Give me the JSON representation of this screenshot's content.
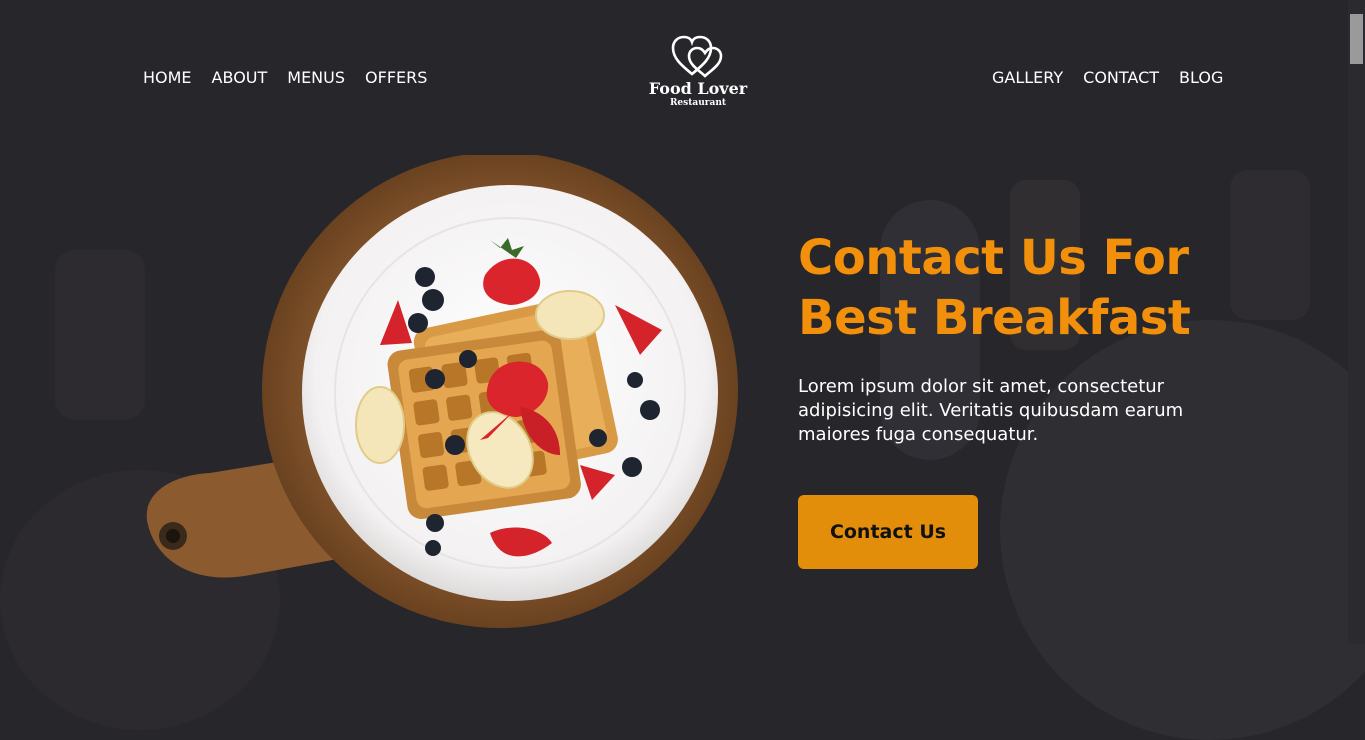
{
  "nav": {
    "left": [
      "HOME",
      "ABOUT",
      "MENUS",
      "OFFERS"
    ],
    "right": [
      "GALLERY",
      "CONTACT",
      "BLOG"
    ]
  },
  "logo": {
    "icon": "hearts-icon",
    "name": "Food Lover",
    "subtitle": "Restaurant"
  },
  "hero": {
    "title_line1": "Contact Us For",
    "title_line2": "Best Breakfast",
    "text": "Lorem ipsum dolor sit amet, consectetur adipisicing elit. Veritatis quibusdam earum maiores fuga consequatur.",
    "cta_label": "Contact Us",
    "image": "waffle-plate-image"
  },
  "colors": {
    "background": "#27262b",
    "accent": "#f2900c",
    "button": "#e38e0b",
    "text": "#ffffff"
  }
}
